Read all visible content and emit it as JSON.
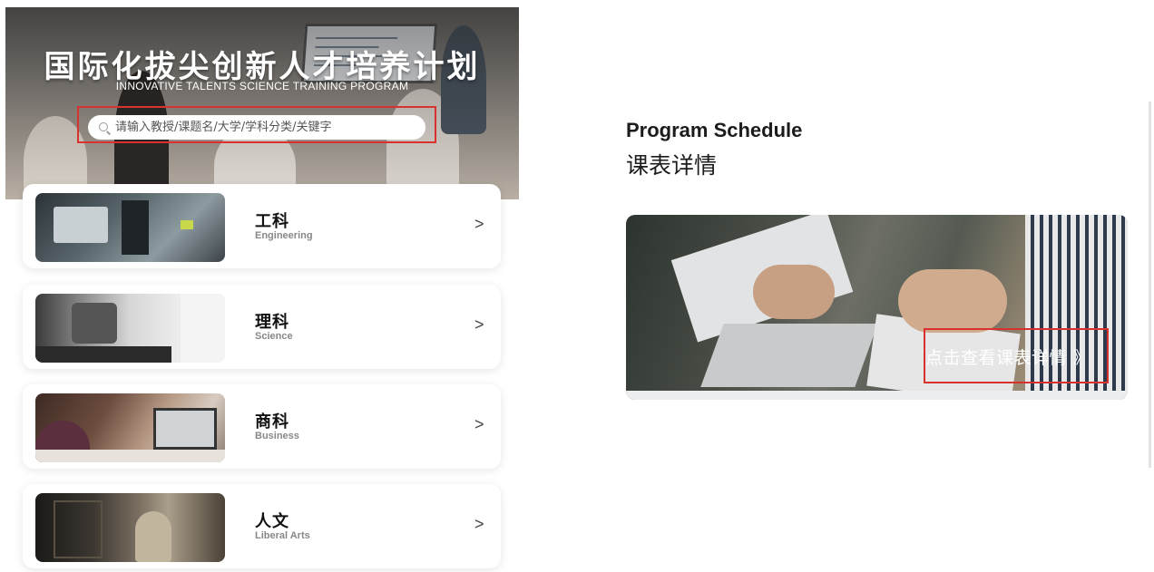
{
  "hero": {
    "title": "国际化拔尖创新人才培养计划",
    "subtitle": "INNOVATIVE TALENTS SCIENCE TRAINING PROGRAM",
    "search_placeholder": "请输入教授/课题名/大学/学科分类/关键字",
    "search_icon": "search-icon"
  },
  "categories": [
    {
      "name": "工科",
      "en": "Engineering",
      "arrow": ">"
    },
    {
      "name": "理科",
      "en": "Science",
      "arrow": ">"
    },
    {
      "name": "商科",
      "en": "Business",
      "arrow": ">"
    },
    {
      "name": "人文",
      "en": "Liberal Arts",
      "arrow": ">"
    }
  ],
  "schedule": {
    "title": "Program Schedule",
    "subtitle": "课表详情",
    "cta": "点击查看课表详情 》"
  },
  "colors": {
    "highlight_border": "#d9322e",
    "text_dark": "#1c1c1c",
    "text_muted": "#888888"
  }
}
